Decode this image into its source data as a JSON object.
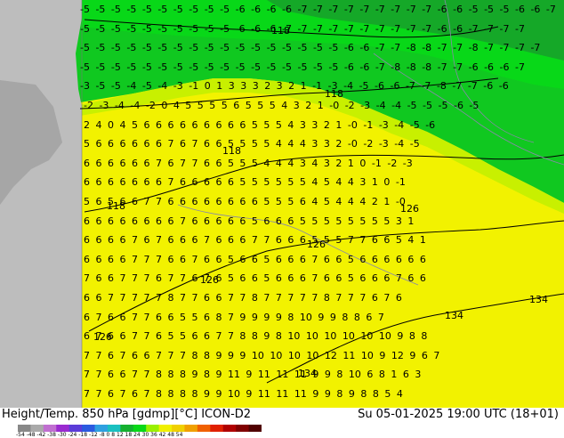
{
  "title_left": "Height/Temp. 850 hPa [gdmp][°C] ICON-D2",
  "title_right": "Su 05-01-2025 19:00 UTC (18+01)",
  "colorbar": {
    "ticks": "-54 -48 -42 -38 -30 -24 -18 -12 -8 0 8 12 18 24 30 36 42 48 54",
    "colors": [
      "#888888",
      "#aaaaaa",
      "#c06fd0",
      "#9a2bd0",
      "#5b3cd8",
      "#2b5ae0",
      "#2fa0e0",
      "#1ac0c0",
      "#15b030",
      "#08d818",
      "#9af000",
      "#f0f000",
      "#f0d000",
      "#f0a000",
      "#f06000",
      "#e02000",
      "#b00000",
      "#800000",
      "#500000"
    ]
  },
  "contour_labels": [
    "118",
    "118",
    "118",
    "118",
    "126",
    "126",
    "126",
    "126",
    "134",
    "134",
    "134"
  ],
  "temperature_rows": [
    "-5 -5 -5 -5 -5 -5 -5 -5 -5 -5 -6 -6 -6 -6 -7 -7 -7 -7 -7 -7 -7 -7 -7 -6 -6 -5 -5 -5 -6 -6 -7",
    "-5 -5 -5 -5 -5 -5 -5 -5 -5 -5 -6 -6 -6 -7 -7 -7 -7 -7 -7 -7 -7 -7 -7 -6 -6 -7 -7 -7 -7",
    "-5 -5 -5 -5 -5 -5 -5 -5 -5 -5 -5 -5 -5 -5 -5 -5 -5 -6 -6 -7 -7 -8 -8 -7 -7 -8 -7 -7 -7 -7",
    "-5 -5 -5 -5 -5 -5 -5 -5 -5 -5 -5 -5 -5 -5 -5 -5 -5 -6 -6 -7 -8 -8 -8 -7 -7 -6 -6 -6 -7",
    "-3 -5 -5 -4 -5 -4 -3 -1 0 1 3 3 3 2 3 2 1 -1 -3 -4 -5 -6 -6 -7 -7 -8 -7 -7 -6 -6",
    "-2 -3 -4 -4 -2 0 4 5 5 5 5 6 5 5 5 4 3 2 1 -0 -2 -3 -4 -4 -5 -5 -5 -6 -5",
    "2 4 0 4 5 6 6 6 6 6 6 6 6 6 5 5 5 4 3 3 2 1 -0 -1 -3 -4 -5 -6",
    "5 6 6 6 6 6 6 7 6 7 6 6 5 5 5 5 4 4 4 3 3 2 -0 -2 -3 -4 -5",
    "6 6 6 6 6 6 7 6 7 7 6 6 5 5 5 4 4 4 3 4 3 2 1 0 -1 -2 -3",
    "6 6 6 6 6 6 6 7 6 6 6 6 6 5 5 5 5 5 5 4 5 4 4 3 1 0 -1",
    "5 6 5 6 6 7 7 6 6 6 6 6 6 6 6 5 5 5 6 4 5 4 4 4 2 1 -0",
    "6 6 6 6 6 6 6 6 7 6 6 6 6 6 5 6 6 6 5 5 5 5 5 5 5 5 3 1",
    "6 6 6 6 7 6 7 6 6 6 7 6 6 6 7 7 6 6 6 5 5 5 7 7 6 6 5 4 1",
    "6 6 6 6 7 7 7 6 6 7 6 6 5 6 6 5 6 6 6 7 6 6 5 6 6 6 6 6 6",
    "7 6 6 7 7 7 6 7 7 6 7 6 5 6 6 5 6 6 6 7 6 6 5 6 6 6 7 6 6",
    "6 6 7 7 7 7 7 8 7 7 6 6 7 7 8 7 7 7 7 7 8 7 7 7 6 7 6",
    "6 7 6 6 7 7 6 6 5 5 6 8 7 9 9 9 9 8 10 9 9 8 8 6 7",
    "6 7 6 6 7 7 6 5 5 6 6 7 7 8 8 9 8 10 10 10 10 10 10 9 8 8",
    "7 7 6 7 6 6 7 7 7 8 8 9 9 9 10 10 10 10 12 11 10 9 12 9 6 7",
    "7 7 6 6 7 7 8 8 8 9 8 9 11 9 11 11 11 9 9 8 10 6 8 1 6 3",
    "7 7 6 7 6 7 8 8 8 8 9 9 10 9 11 11 11 9 9 8 9 8 8 5 4"
  ]
}
